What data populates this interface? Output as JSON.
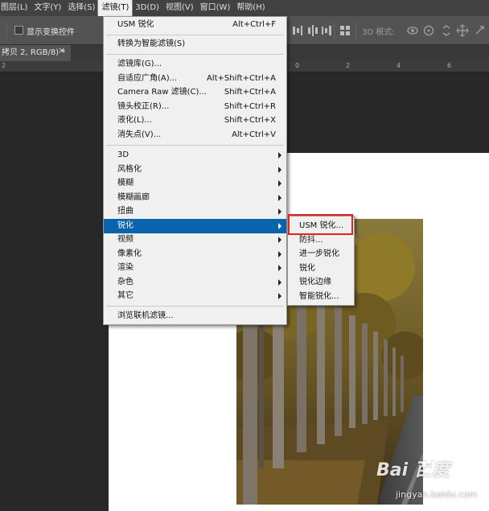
{
  "menubar": {
    "items": [
      {
        "label": "图层(L)"
      },
      {
        "label": "文字(Y)"
      },
      {
        "label": "选择(S)"
      },
      {
        "label": "滤镜(T)"
      },
      {
        "label": "3D(D)"
      },
      {
        "label": "视图(V)"
      },
      {
        "label": "窗口(W)"
      },
      {
        "label": "帮助(H)"
      }
    ]
  },
  "options": {
    "show_transform_controls": "显示变换控件",
    "mode_3d": "3D 模式:"
  },
  "document": {
    "tab_title": "拷贝 2, RGB/8) *",
    "close_glyph": "×"
  },
  "ruler": {
    "labels": [
      "2",
      "0",
      "2",
      "4",
      "6"
    ]
  },
  "filter_menu": {
    "items": [
      {
        "label": "USM 锐化",
        "shortcut": "Alt+Ctrl+F"
      },
      {
        "label": "转换为智能滤镜(S)",
        "shortcut": ""
      },
      {
        "label": "滤镜库(G)...",
        "shortcut": ""
      },
      {
        "label": "自适应广角(A)...",
        "shortcut": "Alt+Shift+Ctrl+A"
      },
      {
        "label": "Camera Raw 滤镜(C)...",
        "shortcut": "Shift+Ctrl+A"
      },
      {
        "label": "镜头校正(R)...",
        "shortcut": "Shift+Ctrl+R"
      },
      {
        "label": "液化(L)...",
        "shortcut": "Shift+Ctrl+X"
      },
      {
        "label": "消失点(V)...",
        "shortcut": "Alt+Ctrl+V"
      },
      {
        "label": "3D",
        "shortcut": ""
      },
      {
        "label": "风格化",
        "shortcut": ""
      },
      {
        "label": "模糊",
        "shortcut": ""
      },
      {
        "label": "模糊画廊",
        "shortcut": ""
      },
      {
        "label": "扭曲",
        "shortcut": ""
      },
      {
        "label": "锐化",
        "shortcut": ""
      },
      {
        "label": "视频",
        "shortcut": ""
      },
      {
        "label": "像素化",
        "shortcut": ""
      },
      {
        "label": "渲染",
        "shortcut": ""
      },
      {
        "label": "杂色",
        "shortcut": ""
      },
      {
        "label": "其它",
        "shortcut": ""
      },
      {
        "label": "浏览联机滤镜...",
        "shortcut": ""
      }
    ]
  },
  "sharpen_submenu": {
    "items": [
      {
        "label": "USM 锐化..."
      },
      {
        "label": "防抖..."
      },
      {
        "label": "进一步锐化"
      },
      {
        "label": "锐化"
      },
      {
        "label": "锐化边缘"
      },
      {
        "label": "智能锐化..."
      }
    ]
  },
  "watermark": {
    "brand": "Bai  百度",
    "url": "jingyan.baidu.com"
  },
  "colors": {
    "highlight": "#0a64ad",
    "callout": "#e0231c",
    "menu_bg": "#f0f0f0"
  }
}
